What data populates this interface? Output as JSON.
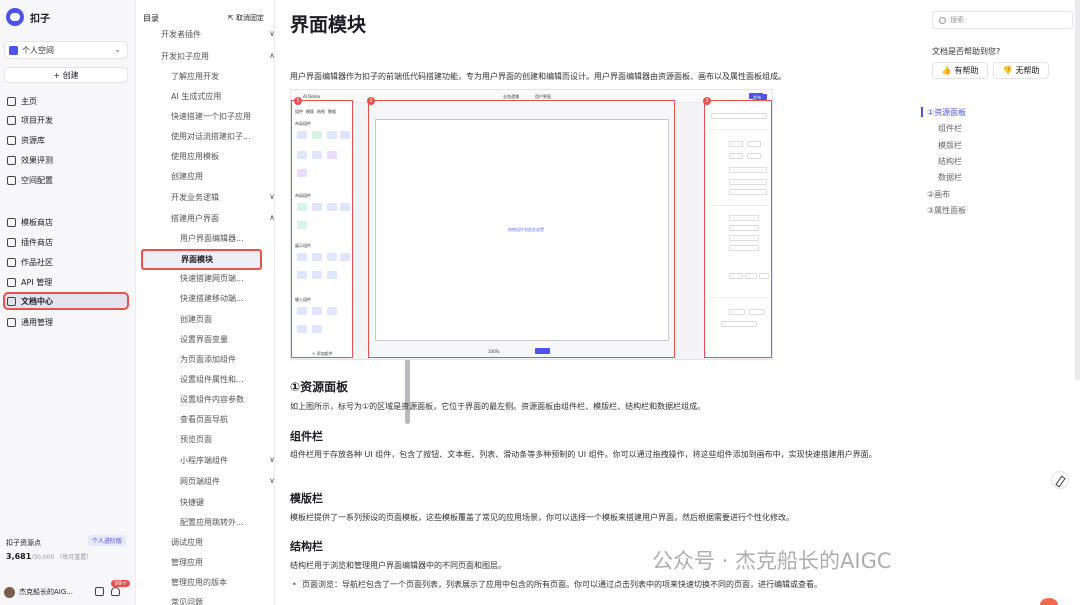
{
  "app": {
    "name": "扣子"
  },
  "sidebar": {
    "space": "个人空间",
    "create_label": "+ 创建",
    "group1": [
      "主页",
      "项目开发",
      "资源库",
      "效果评测",
      "空间配置"
    ],
    "group2": [
      "模板商店",
      "插件商店",
      "作品社区",
      "API 管理",
      "文档中心",
      "通用管理"
    ],
    "resource_title": "扣子资源点",
    "resource_tag": "个人进阶版",
    "resource_used": "3,681",
    "resource_total": "/30,000  （每月重置）",
    "user_name": "杰克船长的AIG...",
    "badge": "99+"
  },
  "toc": {
    "header": "目录",
    "unpin": "取消固定",
    "items": [
      {
        "label": "开发者插件",
        "chev": "∨"
      },
      {
        "label": "开发扣子应用",
        "chev": "∧"
      },
      {
        "label": "了解应用开发",
        "chev": ""
      },
      {
        "label": "AI 生成式应用",
        "chev": ""
      },
      {
        "label": "快速搭建一个扣子应用",
        "chev": ""
      },
      {
        "label": "使用对话流搭建扣子...",
        "chev": ""
      },
      {
        "label": "使用应用模板",
        "chev": ""
      },
      {
        "label": "创建应用",
        "chev": ""
      },
      {
        "label": "开发业务逻辑",
        "chev": "∨"
      },
      {
        "label": "搭建用户界面",
        "chev": "∧"
      },
      {
        "label": "用户界面编辑器...",
        "chev": ""
      },
      {
        "label": "界面模块",
        "chev": ""
      },
      {
        "label": "快速搭建网页端...",
        "chev": ""
      },
      {
        "label": "快速搭建移动端...",
        "chev": ""
      },
      {
        "label": "创建页面",
        "chev": ""
      },
      {
        "label": "设置界面变量",
        "chev": ""
      },
      {
        "label": "为页面添加组件",
        "chev": ""
      },
      {
        "label": "设置组件属性和...",
        "chev": ""
      },
      {
        "label": "设置组件内容参数",
        "chev": ""
      },
      {
        "label": "查看页面导航",
        "chev": ""
      },
      {
        "label": "预览页面",
        "chev": ""
      },
      {
        "label": "小程序端组件",
        "chev": "∨"
      },
      {
        "label": "网页端组件",
        "chev": "∨"
      },
      {
        "label": "快捷键",
        "chev": ""
      },
      {
        "label": "配置应用跳转外...",
        "chev": ""
      },
      {
        "label": "调试应用",
        "chev": ""
      },
      {
        "label": "管理应用",
        "chev": ""
      },
      {
        "label": "管理应用的版本",
        "chev": ""
      },
      {
        "label": "常见问题",
        "chev": ""
      }
    ]
  },
  "main": {
    "title": "界面模块",
    "intro": "用户界面编辑器作为扣子的前端低代码搭建功能，专为用户界面的创建和编辑而设计。用户界面编辑器由资源面板、画布以及属性面板组成。",
    "h_resource": "①资源面板",
    "p_resource": "如上图所示，标号为①的区域是资源面板，它位于界面的最左侧。资源面板由组件栏、模版栏、结构栏和数据栏组成。",
    "h_component": "组件栏",
    "p_component": "组件栏用于存放各种 UI 组件，包含了按钮、文本框、列表、滑动条等多种预制的 UI 组件。你可以通过拖拽操作，将这些组件添加到画布中，实现快速搭建用户界面。",
    "h_template": "模版栏",
    "p_template": "模板栏提供了一系列预设的页面模板，这些模板覆盖了常见的应用场景，你可以选择一个模板来搭建用户界面，然后根据需要进行个性化修改。",
    "h_structure": "结构栏",
    "p_structure": "结构栏用于浏览和管理用户界面编辑器中的不同页面和图层。",
    "bullet1": "页面浏览：导航栏包含了一个页面列表，列表展示了应用中包含的所有页面。你可以通过点击列表中的项来快速切换不同的页面，进行编辑或查看。"
  },
  "shot": {
    "app_label": "AI Demo",
    "tabs": [
      "组件",
      "模版",
      "结构",
      "数据"
    ],
    "sections": [
      "布局组件",
      "布局组件",
      "展示组件",
      "输入组件"
    ],
    "canvas_hint": "拖拽组件到此处放置",
    "zoom": "100%",
    "add_btn": "+ 添加组件",
    "badges": [
      "1",
      "2",
      "3"
    ],
    "top_tabs": [
      "业务逻辑",
      "用户界面"
    ],
    "publish": "发布"
  },
  "right": {
    "search_placeholder": "搜索",
    "help_question": "文档是否帮助到您?",
    "yes": "有帮助",
    "no": "无帮助",
    "toc": [
      "①资源面板",
      "组件栏",
      "模版栏",
      "结构栏",
      "数据栏",
      "②画布",
      "③属性面板"
    ]
  },
  "watermark": "公众号 · 杰克船长的AIGC",
  "colors": {
    "accent": "#4d53e8",
    "highlight": "#e8524a"
  }
}
